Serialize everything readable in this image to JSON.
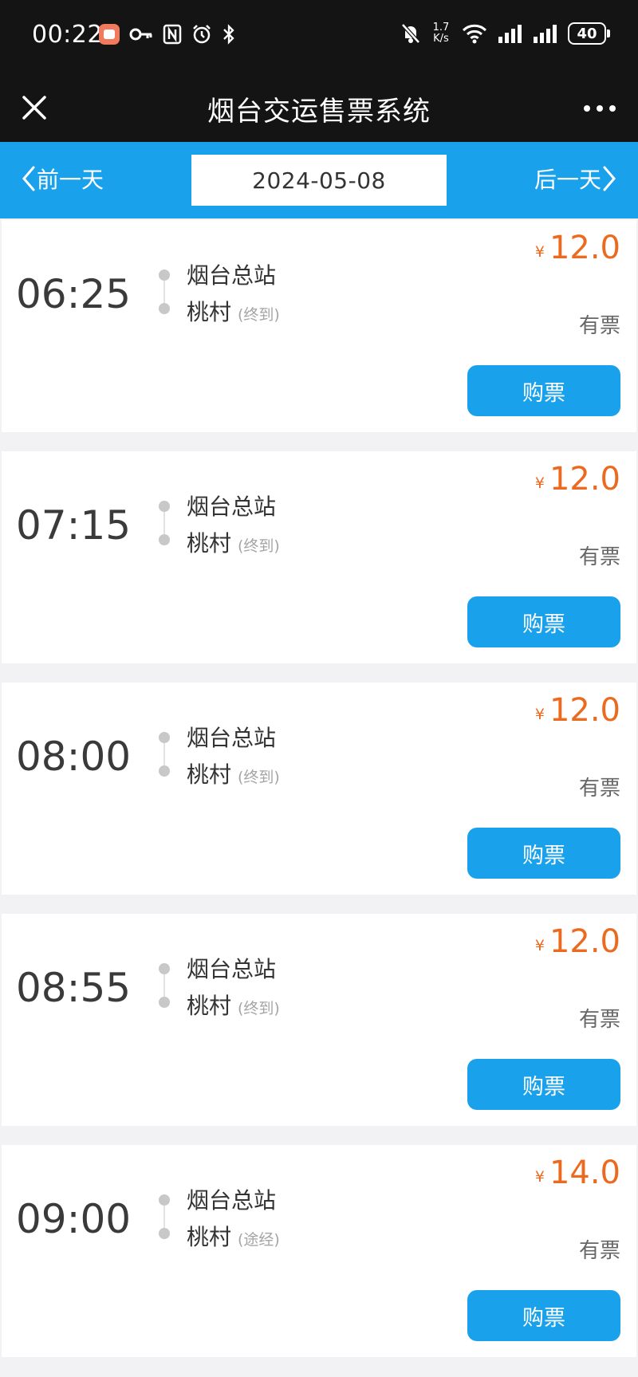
{
  "status_bar": {
    "time": "00:22",
    "net_speed_top": "1.7",
    "net_speed_bottom": "K/s",
    "battery": "40"
  },
  "header": {
    "title": "烟台交运售票系统"
  },
  "date_bar": {
    "prev_label": "前一天",
    "date": "2024-05-08",
    "next_label": "后一天"
  },
  "colors": {
    "accent": "#1aa1eb",
    "price": "#ec6a1f",
    "header_bg": "#141414"
  },
  "trips": [
    {
      "time": "06:25",
      "from": "烟台总站",
      "to": "桃村",
      "tag": "(终到)",
      "currency": "¥",
      "price": "12.0",
      "status": "有票",
      "button": "购票"
    },
    {
      "time": "07:15",
      "from": "烟台总站",
      "to": "桃村",
      "tag": "(终到)",
      "currency": "¥",
      "price": "12.0",
      "status": "有票",
      "button": "购票"
    },
    {
      "time": "08:00",
      "from": "烟台总站",
      "to": "桃村",
      "tag": "(终到)",
      "currency": "¥",
      "price": "12.0",
      "status": "有票",
      "button": "购票"
    },
    {
      "time": "08:55",
      "from": "烟台总站",
      "to": "桃村",
      "tag": "(终到)",
      "currency": "¥",
      "price": "12.0",
      "status": "有票",
      "button": "购票"
    },
    {
      "time": "09:00",
      "from": "烟台总站",
      "to": "桃村",
      "tag": "(途经)",
      "currency": "¥",
      "price": "14.0",
      "status": "有票",
      "button": "购票"
    }
  ]
}
